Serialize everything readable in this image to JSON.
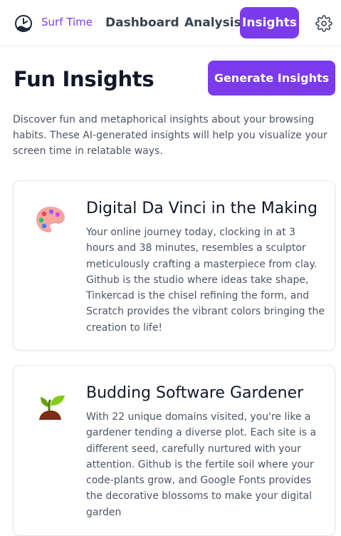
{
  "nav": {
    "brand": "Surf Time",
    "links": [
      "Dashboard",
      "Analysis",
      "Insights"
    ],
    "active_color": "#7c3aed"
  },
  "header": {
    "title": "Fun Insights",
    "generate_label": "Generate Insights"
  },
  "intro": "Discover fun and metaphorical insights about your browsing habits. These AI-generated insights will help you visualize your screen time in relatable ways.",
  "insights": [
    {
      "icon": "palette-icon",
      "title": "Digital Da Vinci in the Making",
      "body": "Your online journey today, clocking in at 3 hours and 38 minutes, resembles a sculptor meticulously crafting a masterpiece from clay. Github is the studio where ideas take shape, Tinkercad is the chisel refining the form, and Scratch provides the vibrant colors bringing the creation to life!"
    },
    {
      "icon": "seedling-icon",
      "title": "Budding Software Gardener",
      "body": "With 22 unique domains visited, you're like a gardener tending a diverse plot. Each site is a different seed, carefully nurtured with your attention. Github is the fertile soil where your code-plants grow, and Google Fonts provides the decorative blossoms to make your digital garden"
    }
  ]
}
